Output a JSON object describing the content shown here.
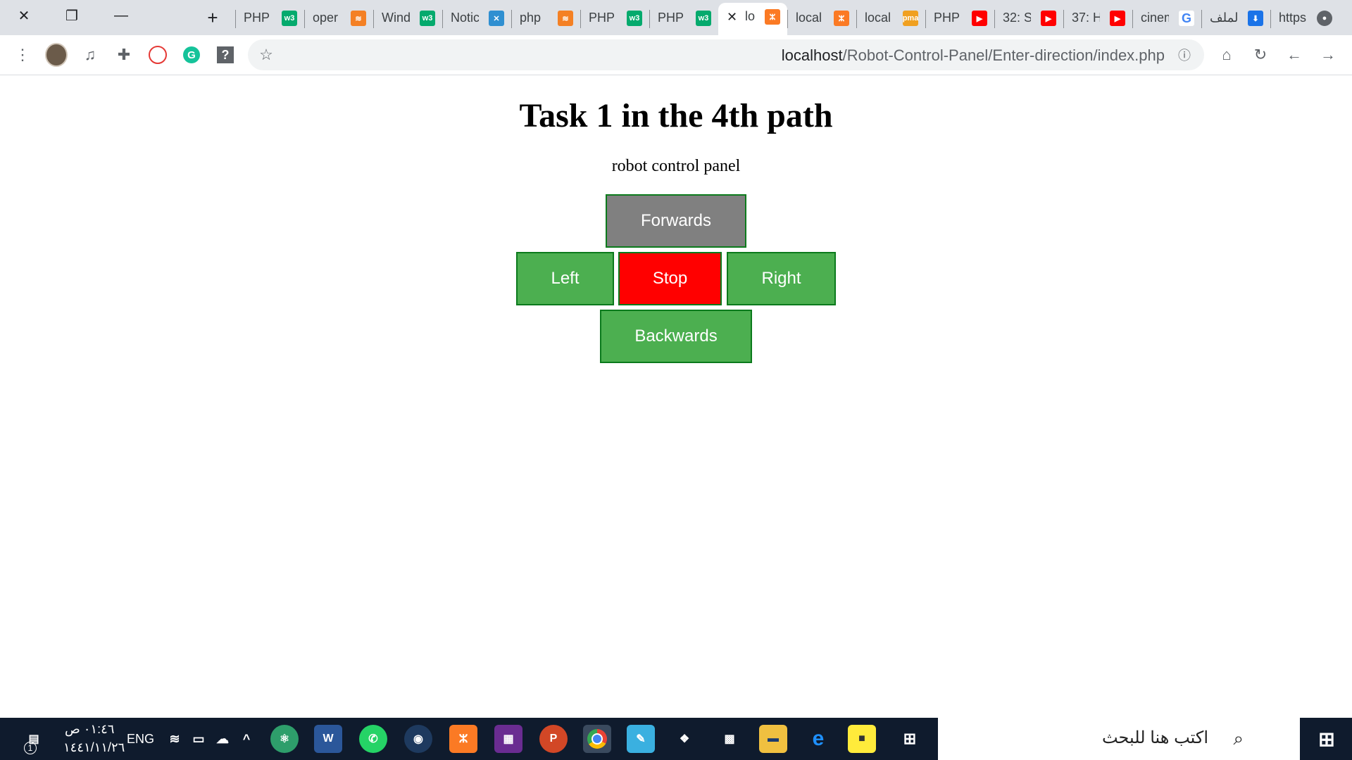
{
  "browser": {
    "tabs": [
      {
        "title": "PHP",
        "fav": "w3"
      },
      {
        "title": "oper",
        "fav": "SO"
      },
      {
        "title": "Wind",
        "fav": "w3"
      },
      {
        "title": "Notic",
        "fav": "Y"
      },
      {
        "title": "php",
        "fav": "SO"
      },
      {
        "title": "PHP",
        "fav": "w3"
      },
      {
        "title": "PHP",
        "fav": "w3"
      },
      {
        "title": "lo",
        "fav": "X",
        "active": true
      },
      {
        "title": "local",
        "fav": "X"
      },
      {
        "title": "local",
        "fav": "PMA"
      },
      {
        "title": "PHP",
        "fav": "YT"
      },
      {
        "title": "32: S",
        "fav": "YT"
      },
      {
        "title": "37: H",
        "fav": "YT"
      },
      {
        "title": "cinem",
        "fav": "G"
      },
      {
        "title": "الملف",
        "fav": "DL"
      },
      {
        "title": "https",
        "fav": "globe"
      }
    ],
    "url_host": "localhost",
    "url_path": "/Robot-Control-Panel/Enter-direction/index.php"
  },
  "page": {
    "title": "Task 1 in the 4th path",
    "subtitle": "robot control panel",
    "buttons": {
      "forwards": "Forwards",
      "left": "Left",
      "stop": "Stop",
      "right": "Right",
      "backwards": "Backwards"
    }
  },
  "taskbar": {
    "search_placeholder": "اكتب هنا للبحث",
    "language": "ENG",
    "time": "٠١:٤٦ ص",
    "date": "١٤٤١/١١/٢٦",
    "notifications_count": "1"
  },
  "colors": {
    "green": "#4caf50",
    "gray": "#808080",
    "red": "#ff0000",
    "taskbar": "#0f1b2d"
  }
}
